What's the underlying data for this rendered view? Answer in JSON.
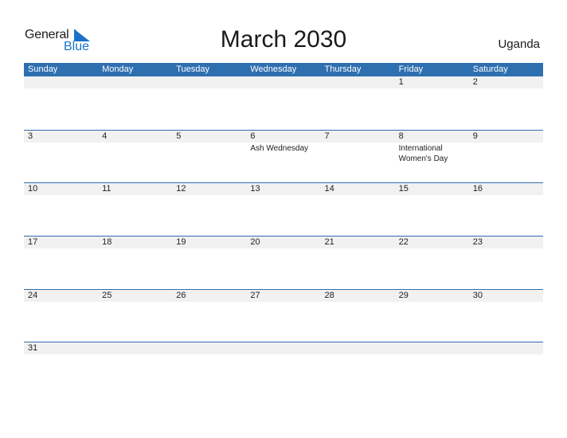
{
  "logo": {
    "general": "General",
    "blue": "Blue"
  },
  "title": "March 2030",
  "country": "Uganda",
  "colors": {
    "accent": "#2e6fb0",
    "date_strip": "#f1f1f1",
    "logo_blue": "#1a73c8"
  },
  "days": [
    "Sunday",
    "Monday",
    "Tuesday",
    "Wednesday",
    "Thursday",
    "Friday",
    "Saturday"
  ],
  "weeks": [
    [
      {
        "d": "",
        "e": ""
      },
      {
        "d": "",
        "e": ""
      },
      {
        "d": "",
        "e": ""
      },
      {
        "d": "",
        "e": ""
      },
      {
        "d": "",
        "e": ""
      },
      {
        "d": "1",
        "e": ""
      },
      {
        "d": "2",
        "e": ""
      }
    ],
    [
      {
        "d": "3",
        "e": ""
      },
      {
        "d": "4",
        "e": ""
      },
      {
        "d": "5",
        "e": ""
      },
      {
        "d": "6",
        "e": "Ash Wednesday"
      },
      {
        "d": "7",
        "e": ""
      },
      {
        "d": "8",
        "e": "International Women's Day"
      },
      {
        "d": "9",
        "e": ""
      }
    ],
    [
      {
        "d": "10",
        "e": ""
      },
      {
        "d": "11",
        "e": ""
      },
      {
        "d": "12",
        "e": ""
      },
      {
        "d": "13",
        "e": ""
      },
      {
        "d": "14",
        "e": ""
      },
      {
        "d": "15",
        "e": ""
      },
      {
        "d": "16",
        "e": ""
      }
    ],
    [
      {
        "d": "17",
        "e": ""
      },
      {
        "d": "18",
        "e": ""
      },
      {
        "d": "19",
        "e": ""
      },
      {
        "d": "20",
        "e": ""
      },
      {
        "d": "21",
        "e": ""
      },
      {
        "d": "22",
        "e": ""
      },
      {
        "d": "23",
        "e": ""
      }
    ],
    [
      {
        "d": "24",
        "e": ""
      },
      {
        "d": "25",
        "e": ""
      },
      {
        "d": "26",
        "e": ""
      },
      {
        "d": "27",
        "e": ""
      },
      {
        "d": "28",
        "e": ""
      },
      {
        "d": "29",
        "e": ""
      },
      {
        "d": "30",
        "e": ""
      }
    ],
    [
      {
        "d": "31",
        "e": ""
      },
      {
        "d": "",
        "e": ""
      },
      {
        "d": "",
        "e": ""
      },
      {
        "d": "",
        "e": ""
      },
      {
        "d": "",
        "e": ""
      },
      {
        "d": "",
        "e": ""
      },
      {
        "d": "",
        "e": ""
      }
    ]
  ]
}
